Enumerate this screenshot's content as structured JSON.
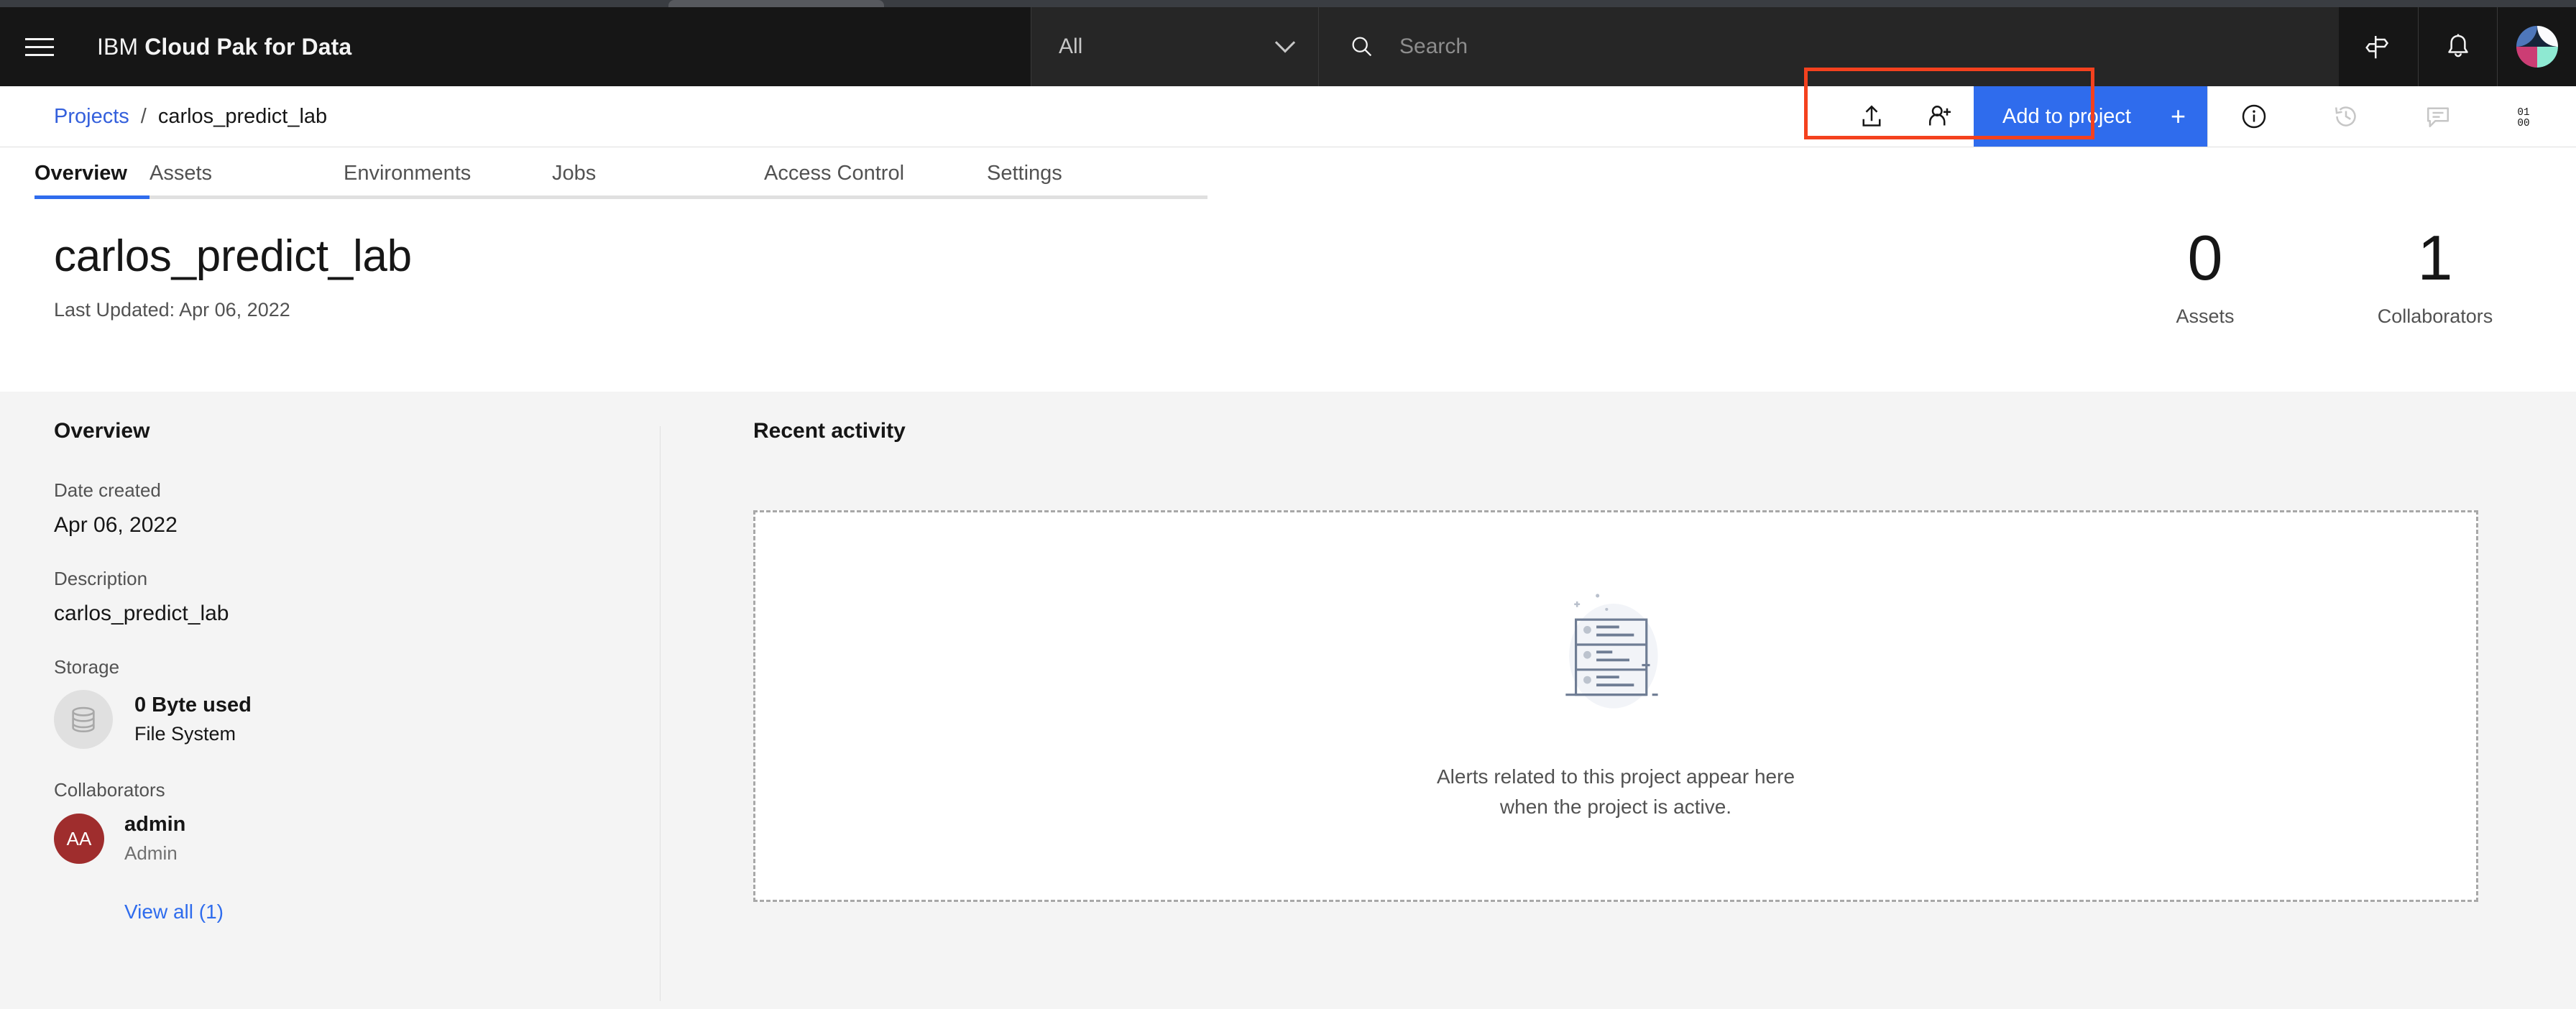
{
  "header": {
    "menu_icon": "hamburger-menu-icon",
    "brand_light": "IBM",
    "brand_bold": "Cloud Pak for Data",
    "scope_value": "All",
    "scope_chevron_icon": "chevron-down-icon",
    "search_icon": "search-icon",
    "search_placeholder": "Search",
    "search_value": "",
    "icons": [
      {
        "name": "signpost-icon"
      },
      {
        "name": "notification-bell-icon"
      }
    ],
    "avatar": {
      "name": "user-avatar",
      "colors": [
        "#4e77bb",
        "#fbfbfd",
        "#cc3d74",
        "#8ee9d2"
      ]
    }
  },
  "actionbar": {
    "breadcrumb": {
      "parent": "Projects",
      "separator": "/",
      "current": "carlos_predict_lab"
    },
    "upload_icon": "upload-icon",
    "add_collaborator_icon": "add-user-icon",
    "add_button_label": "Add to project",
    "add_button_plus": "+",
    "right_icons": [
      {
        "name": "information-icon",
        "state": "active"
      },
      {
        "name": "history-icon",
        "state": "disabled"
      },
      {
        "name": "comment-icon",
        "state": "disabled"
      },
      {
        "name": "binary-data-icon",
        "state": "active"
      }
    ],
    "accent_color": "#2f6ced",
    "highlight_color": "#f4411e"
  },
  "tabs": [
    {
      "label": "Overview",
      "active": true
    },
    {
      "label": "Assets",
      "active": false
    },
    {
      "label": "Environments",
      "active": false
    },
    {
      "label": "Jobs",
      "active": false
    },
    {
      "label": "Access Control",
      "active": false
    },
    {
      "label": "Settings",
      "active": false
    }
  ],
  "project": {
    "title": "carlos_predict_lab",
    "last_updated": "Last Updated: Apr 06, 2022"
  },
  "stats": [
    {
      "value": "0",
      "label": "Assets"
    },
    {
      "value": "1",
      "label": "Collaborators"
    }
  ],
  "sidebar": {
    "heading": "Overview",
    "date_created_label": "Date created",
    "date_created_value": "Apr 06, 2022",
    "description_label": "Description",
    "description_value": "carlos_predict_lab",
    "storage_label": "Storage",
    "storage_icon": "database-icon",
    "storage_used": "0 Byte used",
    "storage_type": "File System",
    "collaborators_label": "Collaborators",
    "collaborator": {
      "initials": "AA",
      "name": "admin",
      "role": "Admin",
      "avatar_color": "#9f2d2d"
    },
    "view_all_label": "View all (1)"
  },
  "main": {
    "heading": "Recent activity",
    "empty_illustration": "activity-list-illustration",
    "empty_line1": "Alerts related to this project appear here",
    "empty_line2": "when the project is active."
  }
}
